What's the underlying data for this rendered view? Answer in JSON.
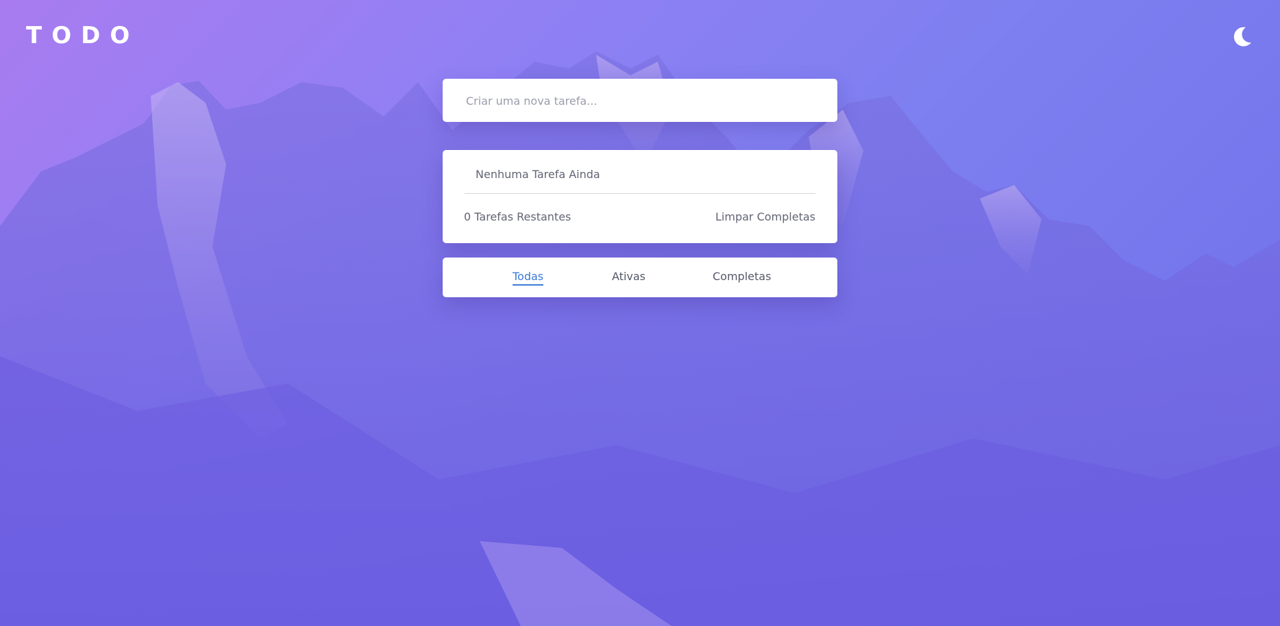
{
  "header": {
    "title": "TODO",
    "theme_icon": "moon-icon"
  },
  "new_task": {
    "placeholder": "Criar uma nova tarefa..."
  },
  "list": {
    "empty_message": "Nenhuma Tarefa Ainda",
    "remaining_label": "0 Tarefas Restantes",
    "clear_label": "Limpar Completas"
  },
  "filters": {
    "all": "Todas",
    "active": "Ativas",
    "completed": "Completas",
    "selected": "all"
  },
  "colors": {
    "accent": "#3a7bd5",
    "background_top": "#a87cf0",
    "background_bottom": "#6f6ee8"
  }
}
